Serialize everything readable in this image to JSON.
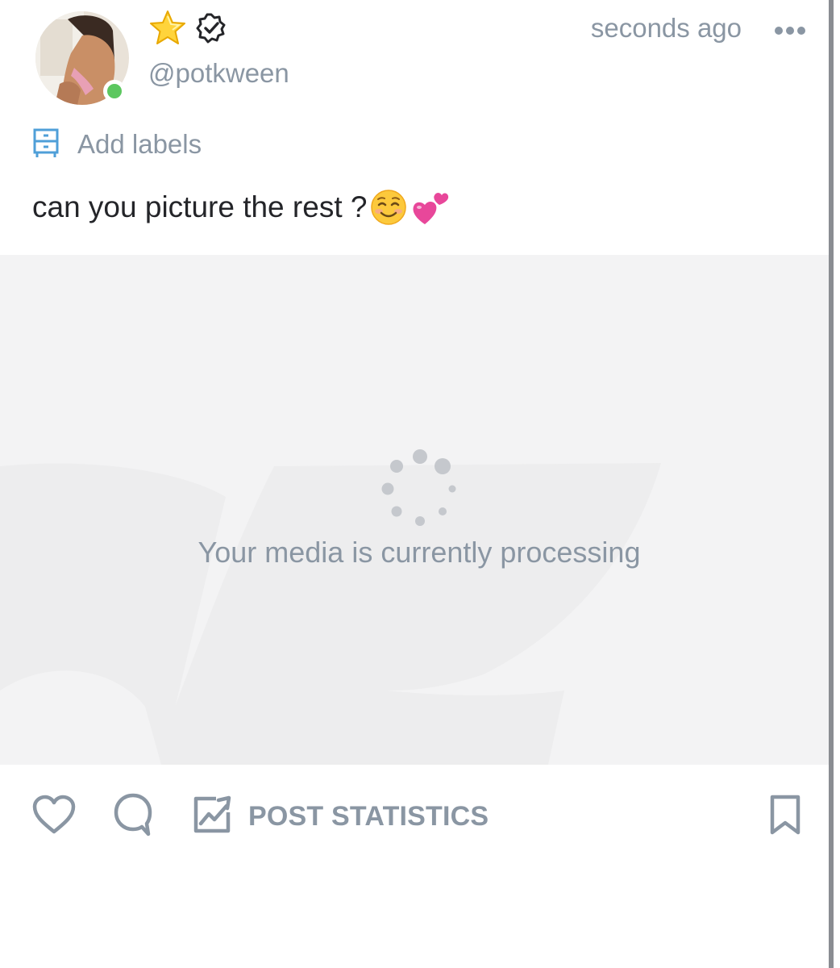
{
  "post": {
    "username": "@potkween",
    "timestamp": "seconds ago",
    "labels_text": "Add labels",
    "caption": "can you picture the rest ?",
    "caption_emojis": [
      "smiling-face-emoji",
      "two-hearts-emoji"
    ],
    "media": {
      "status_text": "Your media is currently processing"
    },
    "actions": {
      "stats_label": "POST STATISTICS"
    },
    "icons": {
      "badge_star": "star-icon",
      "badge_verified": "verified-icon",
      "more": "more-dots-icon",
      "labels": "labels-icon",
      "like": "heart-icon",
      "comment": "comment-icon",
      "stats": "stats-icon",
      "bookmark": "bookmark-icon"
    },
    "online": true
  },
  "colors": {
    "muted_text": "#8a96a3",
    "caption_text": "#242529",
    "accent_blue": "#4f9fd8",
    "online_green": "#5cc75f",
    "media_bg": "#f3f3f4"
  }
}
